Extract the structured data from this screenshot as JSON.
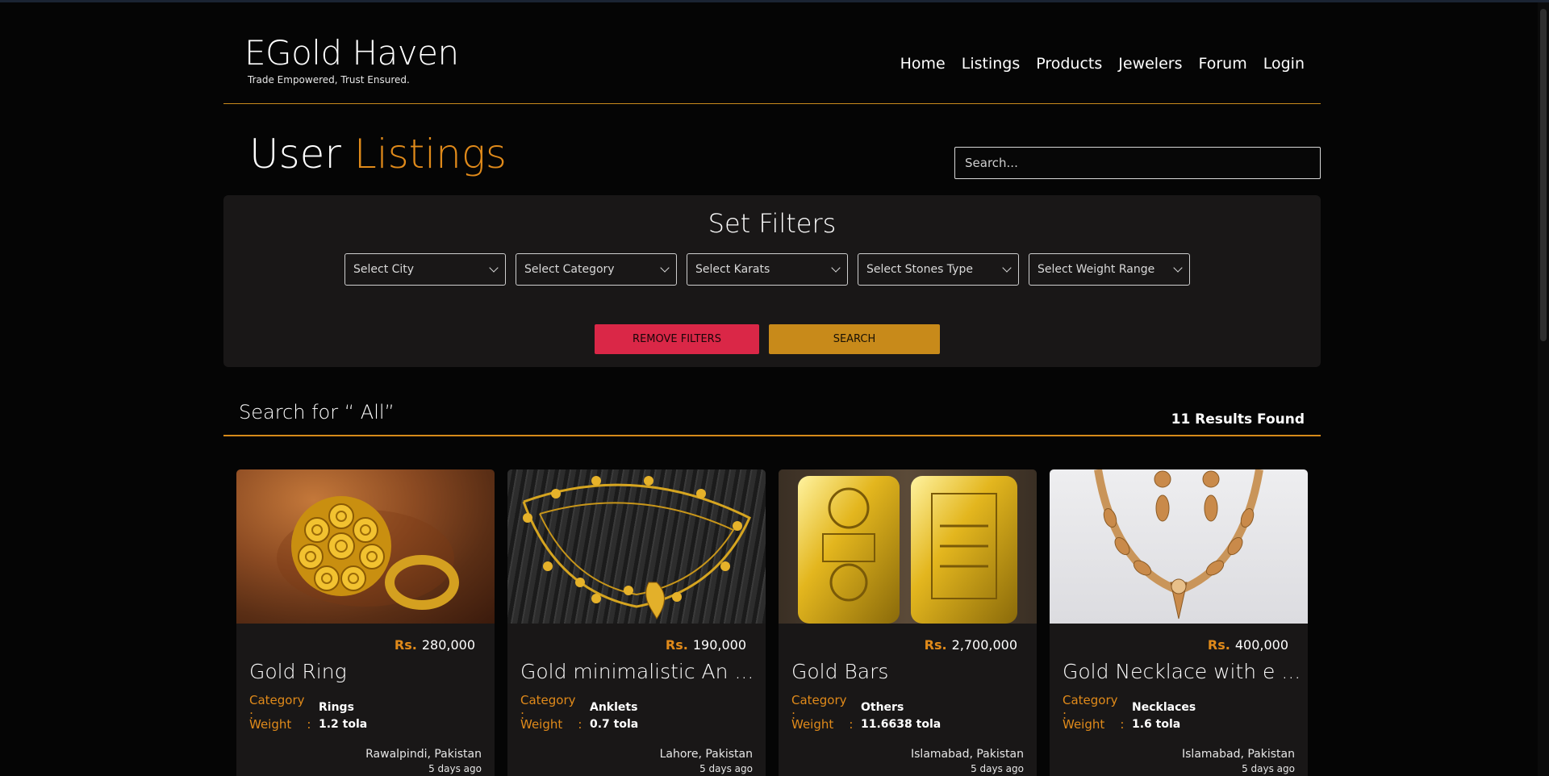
{
  "brand": {
    "name": "EGold Haven",
    "tagline": "Trade Empowered, Trust Ensured."
  },
  "nav": [
    "Home",
    "Listings",
    "Products",
    "Jewelers",
    "Forum",
    "Login"
  ],
  "page": {
    "title_main": "User",
    "title_accent": "Listings",
    "search_placeholder": "Search..."
  },
  "filters": {
    "title": "Set Filters",
    "selects": [
      "Select City",
      "Select Category",
      "Select Karats",
      "Select Stones Type",
      "Select Weight Range"
    ],
    "remove_label": "REMOVE FILTERS",
    "search_label": "SEARCH"
  },
  "results": {
    "search_for": "Search for “ All”",
    "count": "11 Results Found"
  },
  "labels": {
    "category": "Category",
    "weight": "Weight",
    "currency": "Rs."
  },
  "listings": [
    {
      "price": "280,000",
      "title": "Gold Ring",
      "category": "Rings",
      "weight": "1.2 tola",
      "location": "Rawalpindi, Pakistan",
      "ago": "5 days ago",
      "image": "gold-ring-image"
    },
    {
      "price": "190,000",
      "title": "Gold minimalistic An ...",
      "category": "Anklets",
      "weight": "0.7 tola",
      "location": "Lahore, Pakistan",
      "ago": "5 days ago",
      "image": "gold-anklet-image"
    },
    {
      "price": "2,700,000",
      "title": "Gold Bars",
      "category": "Others",
      "weight": "11.6638 tola",
      "location": "Islamabad, Pakistan",
      "ago": "5 days ago",
      "image": "gold-bars-image"
    },
    {
      "price": "400,000",
      "title": "Gold Necklace with e ...",
      "category": "Necklaces",
      "weight": "1.6 tola",
      "location": "Islamabad, Pakistan",
      "ago": "5 days ago",
      "image": "gold-necklace-image"
    }
  ],
  "colors": {
    "accent": "#e08a1a",
    "danger": "#da2747",
    "gold": "#c88a1a",
    "panel": "#191717"
  }
}
